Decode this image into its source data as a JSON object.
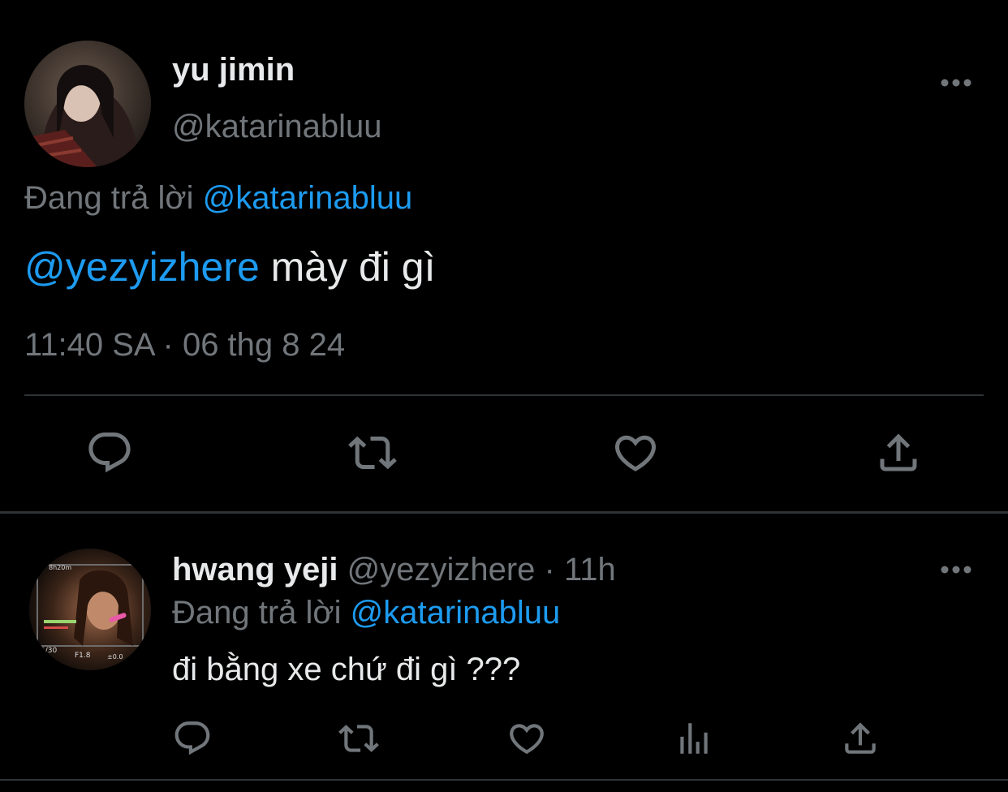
{
  "main_tweet": {
    "name": "yu jimin",
    "handle": "@katarinabluu",
    "replying_prefix": "Đang trả lời",
    "replying_to": "@katarinabluu",
    "mention": "@yezyizhere",
    "text": " mày đi gì",
    "timestamp": "11:40 SA · 06 thg 8 24",
    "actions": [
      "reply-icon",
      "retweet-icon",
      "like-icon",
      "share-icon"
    ]
  },
  "reply_tweet": {
    "name": "hwang yeji",
    "handle": "@yezyizhere",
    "separator": " · ",
    "time": "11h",
    "replying_prefix": "Đang trả lời",
    "replying_to": "@katarinabluu",
    "text": "đi bằng xe chứ đi gì ???",
    "actions": [
      "reply-icon",
      "retweet-icon",
      "like-icon",
      "views-icon",
      "share-icon"
    ]
  },
  "colors": {
    "background": "#000000",
    "text": "#e7e9ea",
    "muted": "#71767b",
    "accent": "#1d9bf0",
    "divider": "#2f3336"
  }
}
